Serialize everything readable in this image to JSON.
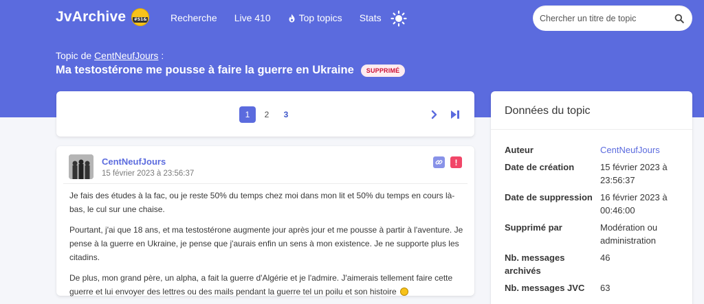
{
  "site": {
    "brand": "JvArchive",
    "logo_text": "#S1&",
    "nav": [
      {
        "label": "Recherche"
      },
      {
        "label": "Live 410"
      },
      {
        "label": "Top topics",
        "icon": "flame-icon"
      },
      {
        "label": "Stats"
      }
    ],
    "theme_toggle_icon": "sun-icon",
    "search_placeholder": "Chercher un titre de topic",
    "colors": {
      "primary": "#5b6bde",
      "danger": "#f14668",
      "deleted_tag_bg": "#feecf0",
      "deleted_tag_text": "#cc0f35"
    }
  },
  "topic": {
    "prefix": "Topic de ",
    "author": "CentNeufJours",
    "suffix": " :",
    "title": "Ma testostérone me pousse à faire la guerre en Ukraine",
    "status_tag": "SUPPRIMÉ"
  },
  "pagination": {
    "pages": [
      "1",
      "2",
      "3"
    ],
    "current": "1",
    "next_icon": "chevron-right-icon",
    "last_icon": "last-page-icon"
  },
  "post": {
    "author": "CentNeufJours",
    "date": "15 février 2023 à 23:56:37",
    "paragraphs": [
      "Je fais des études à la fac, ou je reste 50% du temps chez moi dans mon lit et 50% du temps en cours là-bas, le cul sur une chaise.",
      "Pourtant, j'ai que 18 ans, et ma testostérone augmente jour après jour et me pousse à partir à l'aventure. Je pense à la guerre en Ukraine, je pense que j'aurais enfin un sens à mon existence. Je ne supporte plus les citadins.",
      "De plus, mon grand père, un alpha, a fait la guerre d'Algérie et je l'admire. J'aimerais tellement faire cette guerre et lui envoyer des lettres ou des mails pendant la guerre tel un poilu et son histoire"
    ]
  },
  "sidebar": {
    "title": "Données du topic",
    "rows": [
      {
        "key": "Auteur",
        "value": "CentNeufJours"
      },
      {
        "key": "Date de création",
        "value": "15 février 2023 à 23:56:37"
      },
      {
        "key": "Date de suppression",
        "value": "16 février 2023 à 00:46:00"
      },
      {
        "key": "Supprimé par",
        "value": "Modération ou administration"
      },
      {
        "key": "Nb. messages archivés",
        "value": "46"
      },
      {
        "key": "Nb. messages JVC",
        "value": "63"
      }
    ]
  }
}
